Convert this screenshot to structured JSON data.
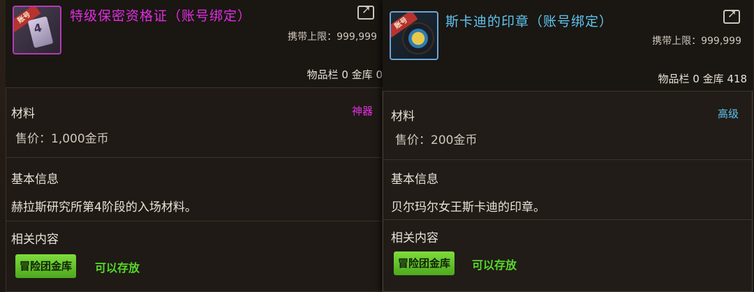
{
  "left_tooltip": {
    "item_name": "特级保密资格证（账号绑定）",
    "icon_ribbon": "账号",
    "icon_number": "4",
    "carry_limit": "携带上限：999,999",
    "inventory": "物品栏 0 金库 0",
    "category": "材料",
    "grade": "神器",
    "price": "售价：1,000金币",
    "basic_info_heading": "基本信息",
    "description": "赫拉斯研究所第4阶段的入场材料。",
    "related_heading": "相关内容",
    "storage_button": "冒险团金库",
    "storage_note": "可以存放",
    "colors": {
      "name": "#e02ee0",
      "grade": "#e02ee0"
    }
  },
  "right_tooltip": {
    "item_name": "斯卡迪的印章（账号绑定）",
    "icon_ribbon": "账号",
    "carry_limit": "携带上限：999,999",
    "inventory": "物品栏 0 金库 418",
    "category": "材料",
    "grade": "高级",
    "price": "售价：200金币",
    "basic_info_heading": "基本信息",
    "description": "贝尔玛尔女王斯卡迪的印章。",
    "related_heading": "相关内容",
    "storage_button": "冒险团金库",
    "storage_note": "可以存放",
    "colors": {
      "name": "#5ec4f0",
      "grade": "#5ec4f0"
    }
  },
  "accent_colors": {
    "storage_button": "#6cc82c",
    "storage_note": "#56d82a"
  }
}
